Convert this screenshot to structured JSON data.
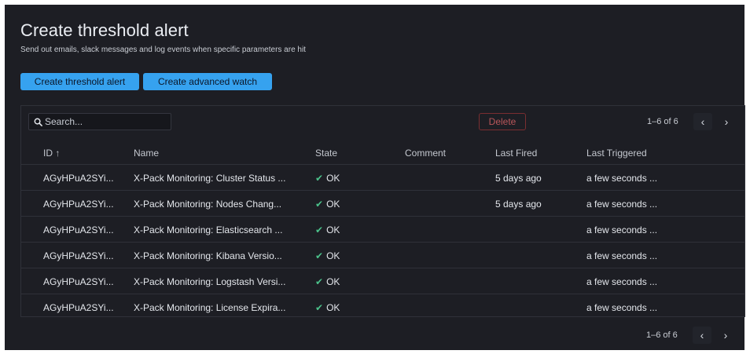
{
  "header": {
    "title": "Create threshold alert",
    "subtitle": "Send out emails, slack messages and log events when specific parameters are hit"
  },
  "buttons": {
    "create_threshold": "Create threshold alert",
    "create_advanced": "Create advanced watch",
    "delete": "Delete"
  },
  "search": {
    "placeholder": "Search...",
    "value": ""
  },
  "pagination": {
    "summary": "1–6 of 6",
    "prev_icon": "chevron-left-icon",
    "next_icon": "chevron-right-icon"
  },
  "columns": {
    "id": "ID ↑",
    "name": "Name",
    "state": "State",
    "comment": "Comment",
    "last_fired": "Last Fired",
    "last_triggered": "Last Triggered"
  },
  "rows": [
    {
      "id": "AGyHPuA2SYi...",
      "name": "X-Pack Monitoring: Cluster Status ...",
      "state": "OK",
      "comment": "",
      "last_fired": "5 days ago",
      "last_triggered": "a few seconds ..."
    },
    {
      "id": "AGyHPuA2SYi...",
      "name": "X-Pack Monitoring: Nodes Chang...",
      "state": "OK",
      "comment": "",
      "last_fired": "5 days ago",
      "last_triggered": "a few seconds ..."
    },
    {
      "id": "AGyHPuA2SYi...",
      "name": "X-Pack Monitoring: Elasticsearch ...",
      "state": "OK",
      "comment": "",
      "last_fired": "",
      "last_triggered": "a few seconds ..."
    },
    {
      "id": "AGyHPuA2SYi...",
      "name": "X-Pack Monitoring: Kibana Versio...",
      "state": "OK",
      "comment": "",
      "last_fired": "",
      "last_triggered": "a few seconds ..."
    },
    {
      "id": "AGyHPuA2SYi...",
      "name": "X-Pack Monitoring: Logstash Versi...",
      "state": "OK",
      "comment": "",
      "last_fired": "",
      "last_triggered": "a few seconds ..."
    },
    {
      "id": "AGyHPuA2SYi...",
      "name": "X-Pack Monitoring: License Expira...",
      "state": "OK",
      "comment": "",
      "last_fired": "",
      "last_triggered": "a few seconds ..."
    }
  ],
  "colors": {
    "background": "#1d1e24",
    "primary_button": "#36a2ef",
    "danger": "#b9565a",
    "success": "#4bc18a"
  },
  "icons": {
    "search": "search-icon",
    "state_ok": "check-icon"
  }
}
